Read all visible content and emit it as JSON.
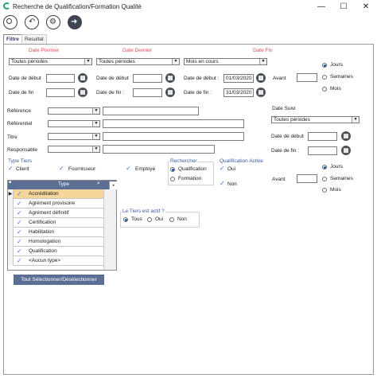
{
  "window": {
    "title": "Recherche de Qualification/Formation Qualité",
    "minimize": "—",
    "maximize": "☐",
    "close": "✕"
  },
  "tabs": [
    {
      "label": "Filtre"
    },
    {
      "label": "Resultat"
    }
  ],
  "date_premier": {
    "header": "Date Premier",
    "period": "Toutes périodes",
    "debut_label": "Date de début",
    "debut_value": "",
    "fin_label": "Date de fin",
    "fin_value": ""
  },
  "date_dernier": {
    "header": "Date Dernier",
    "period": "Toutes périodes",
    "debut_label": "Date de début",
    "debut_value": "",
    "fin_label": "Date de fin :",
    "fin_value": ""
  },
  "date_fin": {
    "header": "Date Fin",
    "period": "Mois en cours",
    "debut_label": "Date de début :",
    "debut_value": "01/03/2020",
    "fin_label": "Date de fin :",
    "fin_value": "31/03/2020",
    "avant_label": "Avant",
    "avant_value": "",
    "units": [
      "Jours",
      "Semaines",
      "Mois"
    ],
    "unit_selected": "Jours"
  },
  "fields": {
    "reference": "Référence",
    "referentiel": "Référentiel",
    "titre": "Titre",
    "responsable": "Responsable"
  },
  "date_suivi": {
    "header": "Date Suivi",
    "period": "Toutes périodes",
    "debut_label": "Date de début",
    "debut_value": "",
    "fin_label": "Date de fin :",
    "fin_value": "",
    "avant_label": "Avant",
    "avant_value": "",
    "units": [
      "Jours",
      "Semaines",
      "Mois"
    ],
    "unit_selected": "Jours"
  },
  "type_tiers": {
    "header": "Type Tiers",
    "options": [
      {
        "label": "Client",
        "checked": true
      },
      {
        "label": "Fournisseur",
        "checked": true
      },
      {
        "label": "Employé",
        "checked": true
      }
    ]
  },
  "rechercher": {
    "header": "Rechercher",
    "options": [
      "Qualification",
      "Formation"
    ],
    "selected": "Qualification"
  },
  "qualification_active": {
    "header": "Qualification Active",
    "options": [
      {
        "label": "Oui",
        "checked": true
      },
      {
        "label": "Non",
        "checked": true
      }
    ]
  },
  "types_grid": {
    "column": "Type",
    "rows": [
      {
        "label": "Accréditation",
        "checked": true,
        "current": true
      },
      {
        "label": "Agrément provisoire",
        "checked": true
      },
      {
        "label": "Agrément définitif",
        "checked": true
      },
      {
        "label": "Certification",
        "checked": true
      },
      {
        "label": "Habilitation",
        "checked": true
      },
      {
        "label": "Homologation",
        "checked": true
      },
      {
        "label": "Qualification",
        "checked": true
      },
      {
        "label": "<Aucun type>",
        "checked": true
      }
    ]
  },
  "tiers_actif": {
    "header": "Le Tiers est actif ?",
    "options": [
      "Tous",
      "Oui",
      "Non"
    ],
    "selected": "Tous"
  },
  "select_all_button": "Tout Sélectionner/Désélectionner",
  "colors": {
    "accent": "#5b6f95",
    "section_red": "#e05050",
    "section_blue": "#3a5aa8",
    "check": "#3b79d0"
  }
}
